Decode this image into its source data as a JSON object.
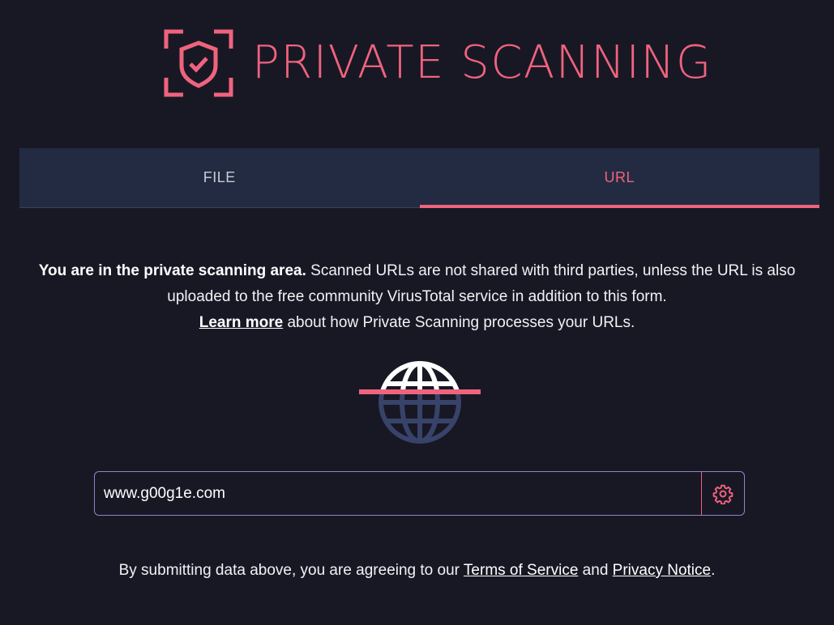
{
  "header": {
    "logo_icon": "shield-check-icon",
    "title": "PRIVATE SCANNING",
    "accent_color": "#f0637d"
  },
  "tabs": [
    {
      "label": "FILE",
      "active": false
    },
    {
      "label": "URL",
      "active": true
    }
  ],
  "info": {
    "bold_lead": "You are in the private scanning area.",
    "text": " Scanned URLs are not shared with third parties, unless the URL is also uploaded to the free community VirusTotal service in addition to this form.",
    "learn_more_link": "Learn more",
    "learn_more_rest": " about how Private Scanning processes your URLs."
  },
  "illustration": {
    "icon": "globe-icon"
  },
  "url_form": {
    "value": "www.g00g1e.com",
    "settings_icon": "gear-icon"
  },
  "footer": {
    "prefix": "By submitting data above, you are agreeing to our ",
    "terms_link": "Terms of Service",
    "and": " and ",
    "privacy_link": "Privacy Notice",
    "suffix": "."
  }
}
